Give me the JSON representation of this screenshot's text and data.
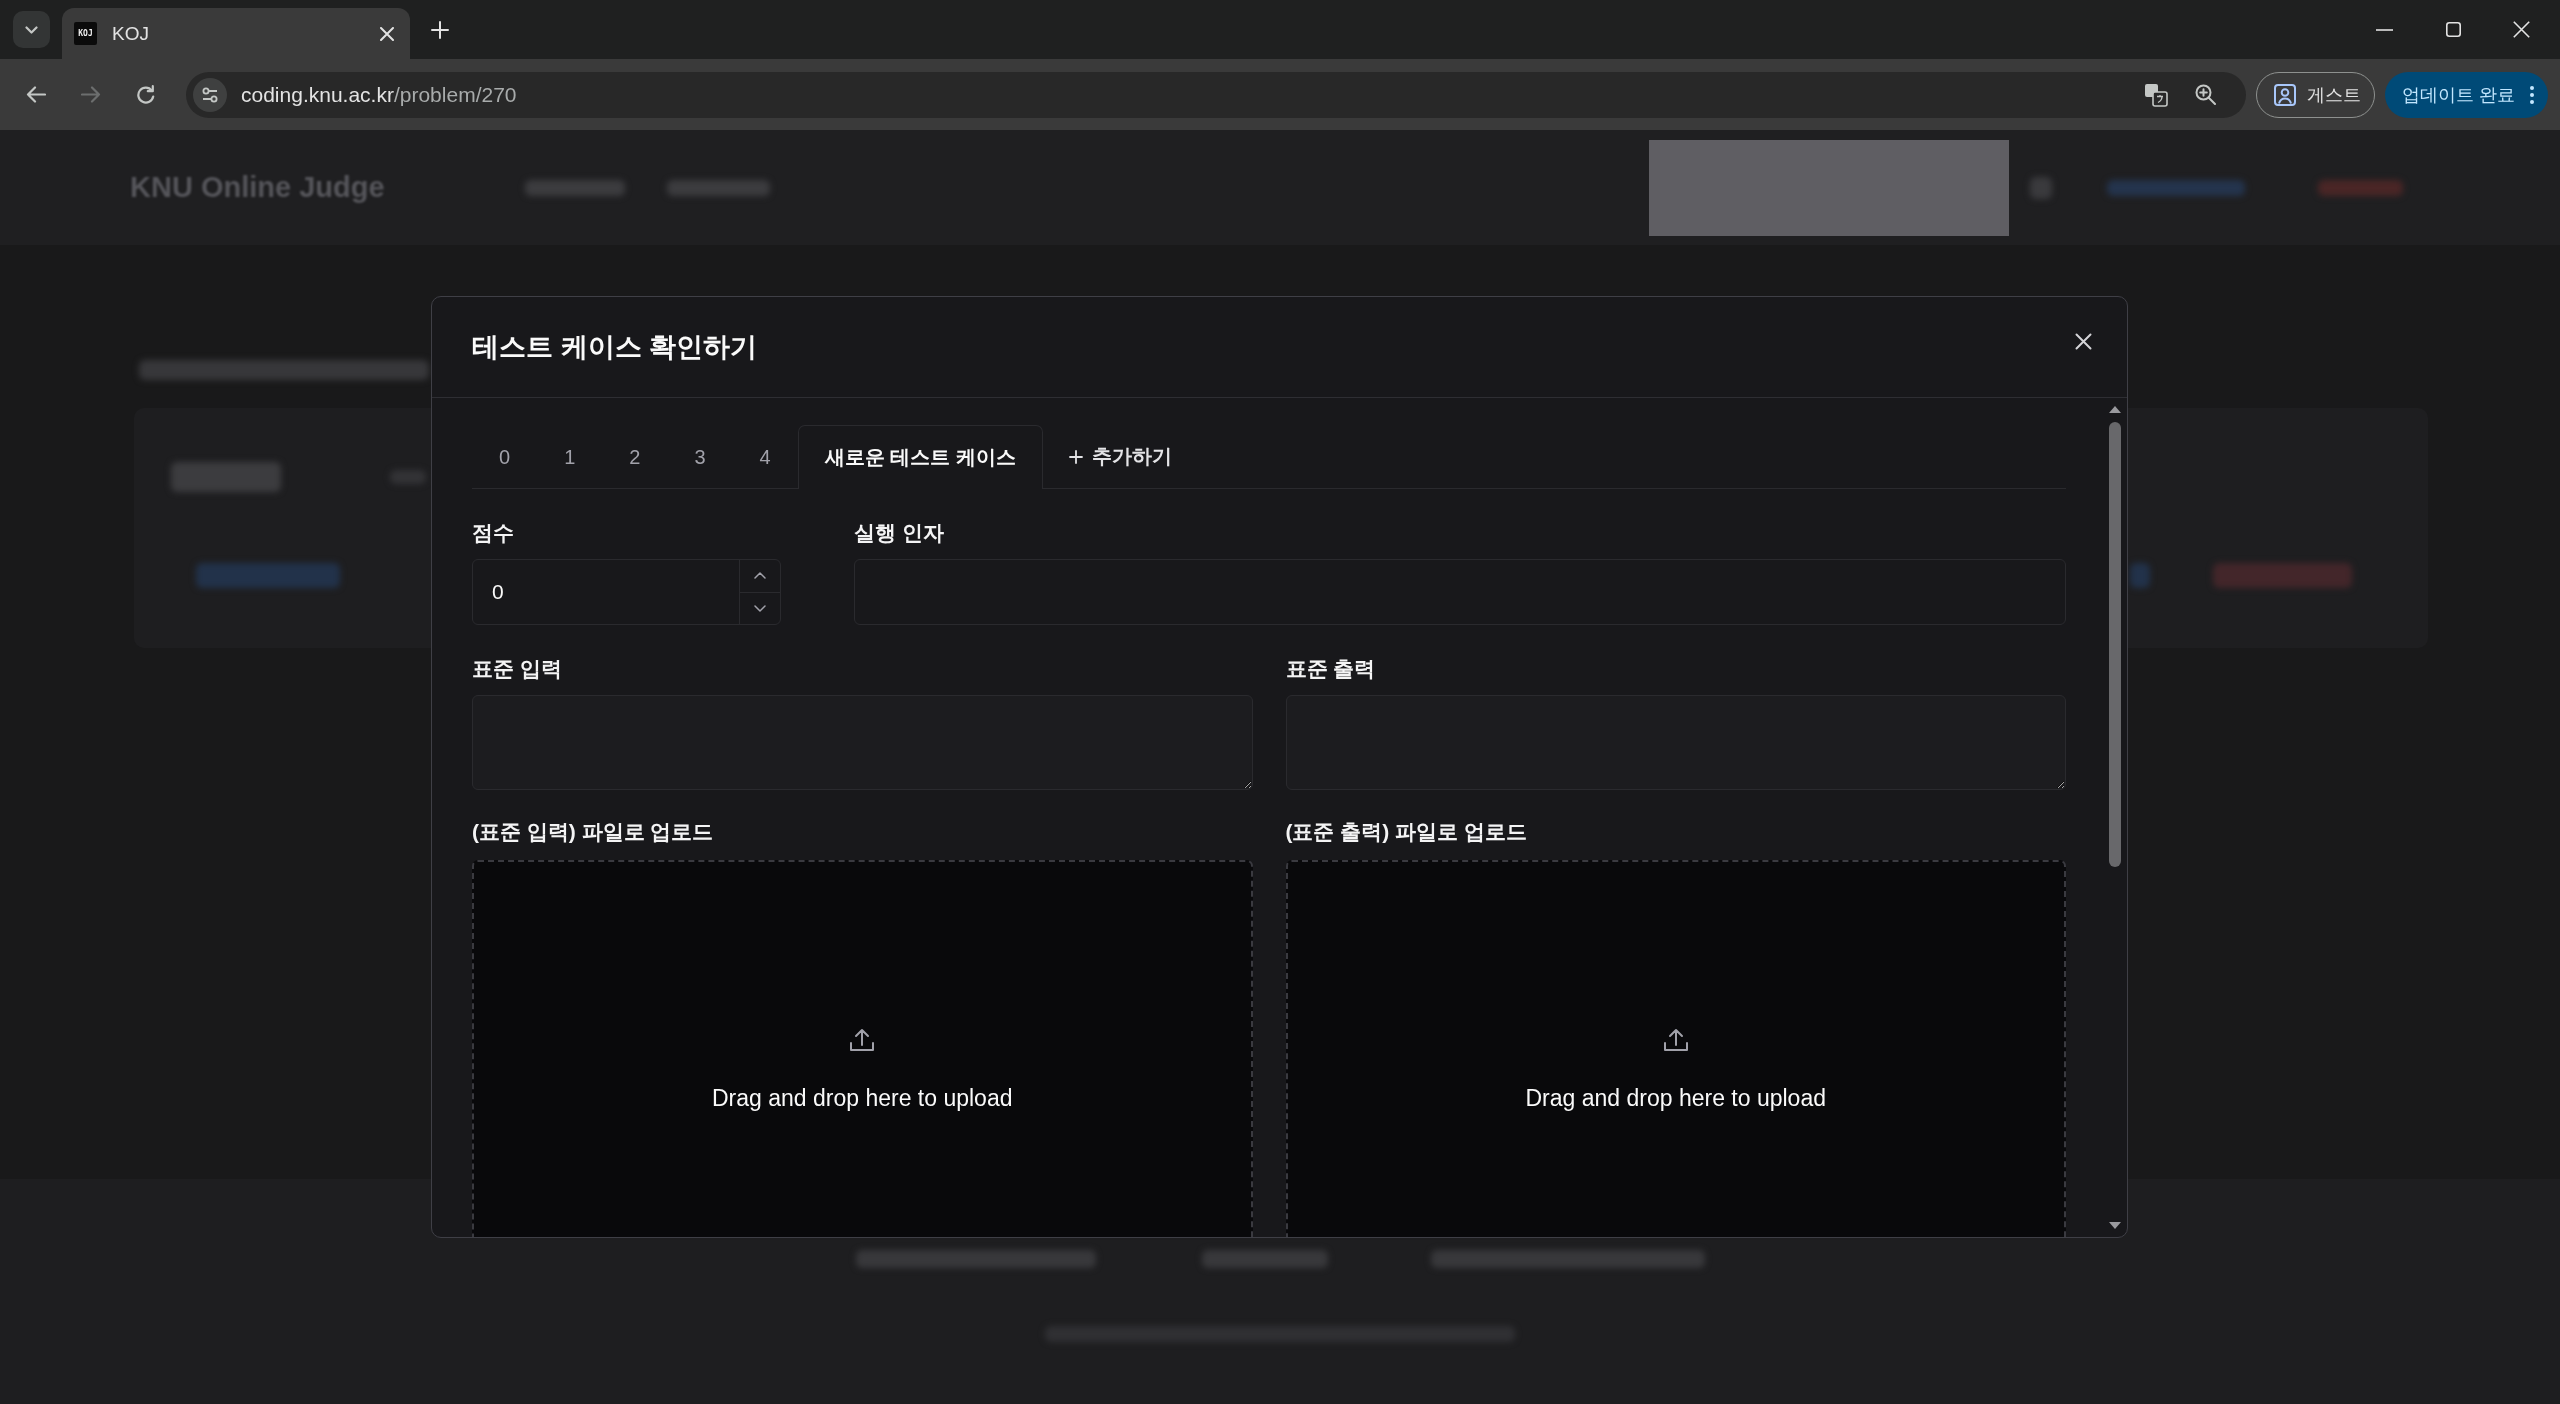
{
  "browser": {
    "tab": {
      "favicon_text": "KOJ",
      "title": "KOJ"
    },
    "navigation": {
      "back_disabled": false,
      "forward_disabled": true
    },
    "address": {
      "host": "coding.knu.ac.kr",
      "path": "/problem/270"
    },
    "profile_label": "게스트",
    "update_label": "업데이트 완료"
  },
  "background_page": {
    "site_title": "KNU Online Judge"
  },
  "modal": {
    "title": "테스트 케이스 확인하기",
    "tabs": [
      {
        "label": "0",
        "selected": false
      },
      {
        "label": "1",
        "selected": false
      },
      {
        "label": "2",
        "selected": false
      },
      {
        "label": "3",
        "selected": false
      },
      {
        "label": "4",
        "selected": false
      },
      {
        "label": "새로운 테스트 케이스",
        "selected": true
      }
    ],
    "add_tab_label": "추가하기",
    "score": {
      "label": "점수",
      "value": "0"
    },
    "arguments": {
      "label": "실행 인자"
    },
    "stdin": {
      "label": "표준 입력"
    },
    "stdout": {
      "label": "표준 출력"
    },
    "uploads": [
      {
        "label": "(표준 입력) 파일로 업로드",
        "hint": "Drag and drop here to upload"
      },
      {
        "label": "(표준 출력) 파일로 업로드",
        "hint": "Drag and drop here to upload"
      }
    ]
  }
}
